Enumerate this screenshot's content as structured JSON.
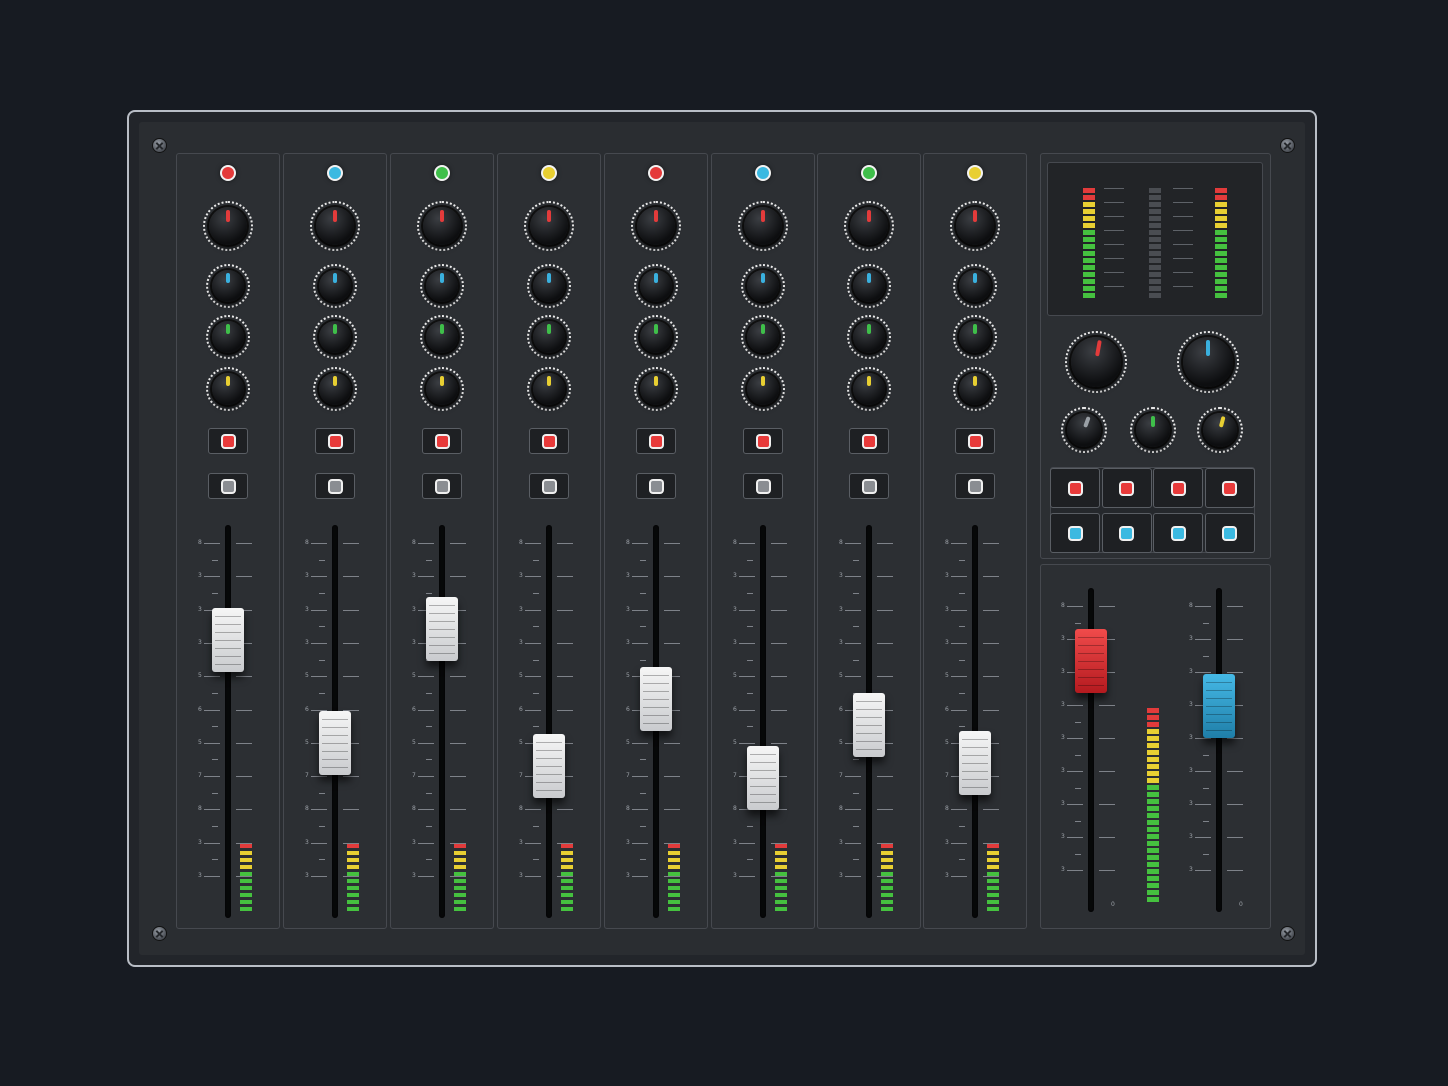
{
  "console": {
    "channel_count": 8,
    "channels": [
      {
        "led_color": "#e43a3a",
        "fader_level": 0.75
      },
      {
        "led_color": "#3bb9e1",
        "fader_level": 0.4
      },
      {
        "led_color": "#3fbf4a",
        "fader_level": 0.79
      },
      {
        "led_color": "#e8cf32",
        "fader_level": 0.32
      },
      {
        "led_color": "#e43a3a",
        "fader_level": 0.55
      },
      {
        "led_color": "#3bb9e1",
        "fader_level": 0.28
      },
      {
        "led_color": "#3fbf4a",
        "fader_level": 0.46
      },
      {
        "led_color": "#e8cf32",
        "fader_level": 0.33
      }
    ],
    "knob_colors": [
      "#e33b3b",
      "#3ab0de",
      "#3fbf4a",
      "#e8cf32"
    ],
    "button_colors": {
      "solo": "#e83a3a",
      "mute": "#8a8d92"
    },
    "fader_scale_labels": [
      "8",
      "3",
      "3",
      "3",
      "5",
      "6",
      "5",
      "7",
      "8",
      "3",
      "3"
    ],
    "master": {
      "meter_left_level": 1.0,
      "meter_right_level": 1.0,
      "aux_knob_colors": [
        "#e33b3b",
        "#3ab0de"
      ],
      "small_knob_colors": [
        "#9aa0a6",
        "#3fbf4a",
        "#e8cf32"
      ],
      "red_button_count": 4,
      "blue_button_count": 4,
      "red_button_color": "#e83a3a",
      "blue_button_color": "#3bb9e1",
      "left_fader_level": 0.86,
      "right_fader_level": 0.66,
      "left_fader_color": "red",
      "right_fader_color": "blue",
      "scale_labels": [
        "8",
        "3",
        "3",
        "3",
        "3",
        "3",
        "3",
        "3",
        "3"
      ],
      "scale_end_label": "0"
    }
  }
}
